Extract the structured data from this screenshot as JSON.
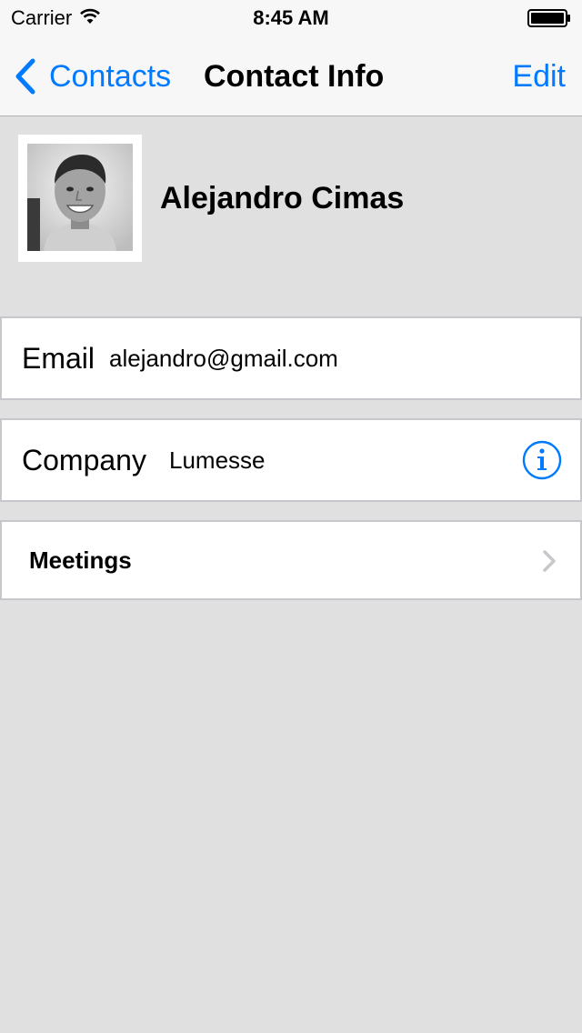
{
  "status_bar": {
    "carrier": "Carrier",
    "time": "8:45 AM",
    "wifi_icon": "wifi-icon",
    "battery_icon": "battery-icon"
  },
  "nav_bar": {
    "back_label": "Contacts",
    "back_icon": "chevron-left-icon",
    "title": "Contact Info",
    "edit_label": "Edit",
    "accent_color": "#007aff"
  },
  "contact": {
    "name": "Alejandro Cimas",
    "avatar_icon": "person-photo"
  },
  "fields": {
    "email_label": "Email",
    "email_value": "alejandro@gmail.com",
    "company_label": "Company",
    "company_value": "Lumesse",
    "company_icon": "info-icon"
  },
  "meetings": {
    "label": "Meetings",
    "icon": "chevron-right-icon"
  },
  "colors": {
    "background": "#e0e0e0",
    "cell_background": "#ffffff",
    "cell_border": "#c8c7cc",
    "nav_background": "#f7f7f7"
  }
}
